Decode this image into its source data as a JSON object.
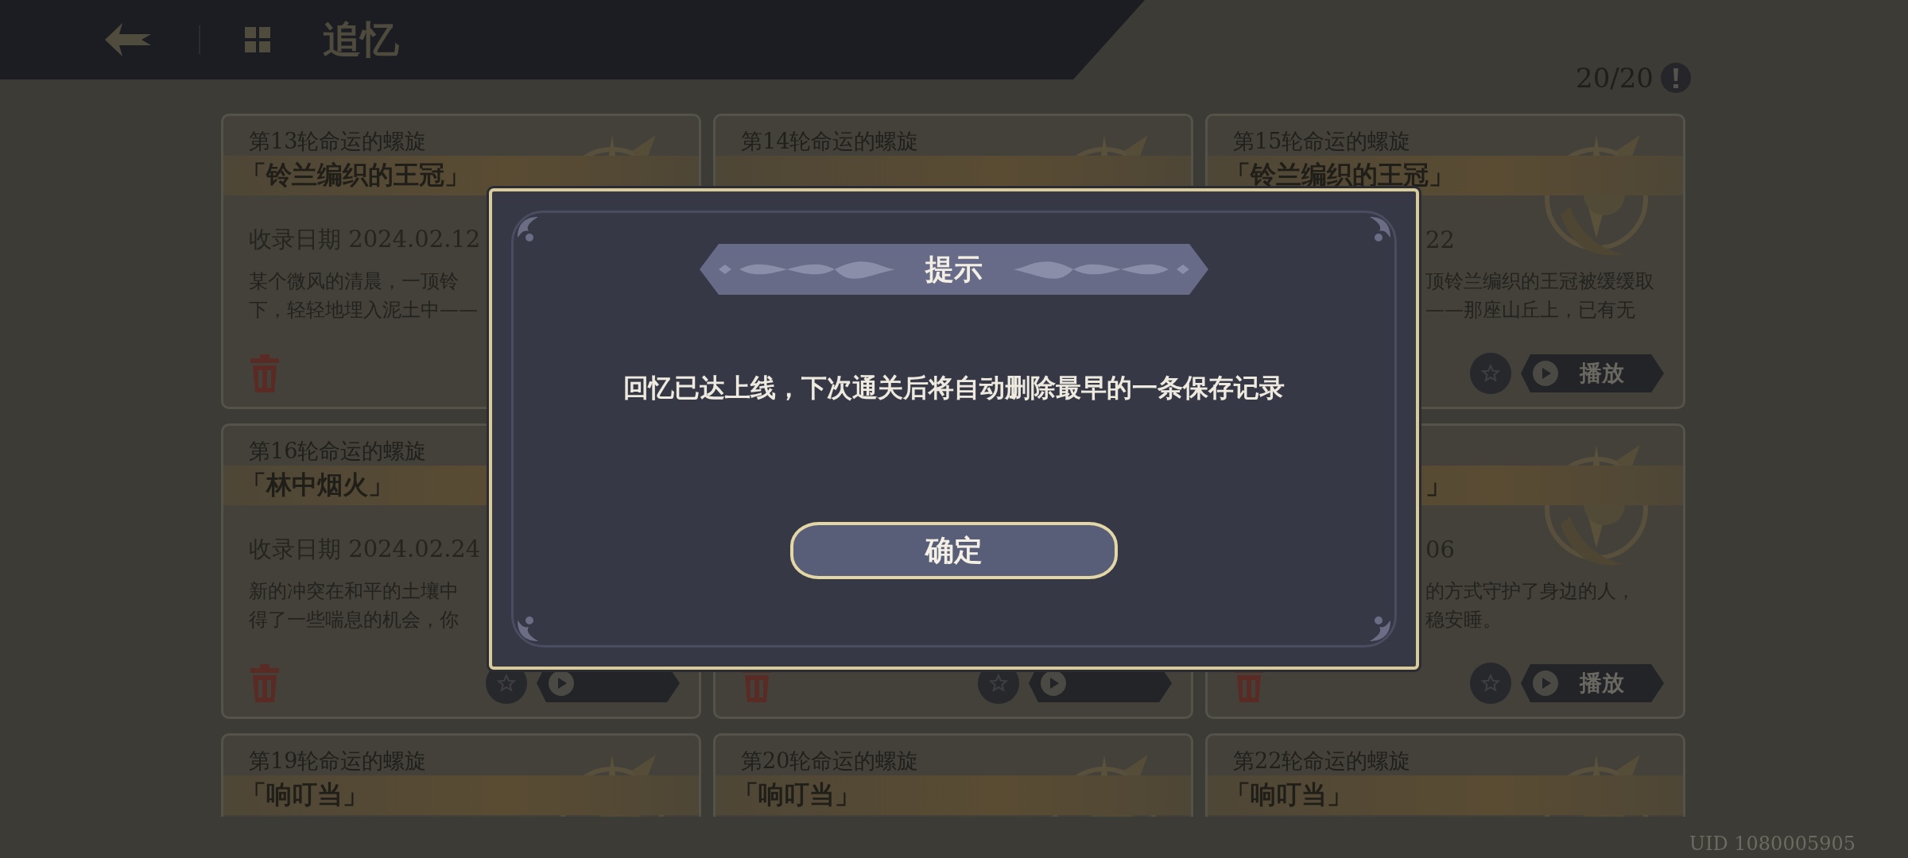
{
  "header": {
    "title": "追忆"
  },
  "counter": {
    "text": "20/20"
  },
  "cards": [
    {
      "emblem": true,
      "title": {
        "text": "第13轮命运的螺旋"
      },
      "subtitle": {
        "text": "「铃兰编织的王冠」",
        "covered_start": false
      },
      "date": {
        "text": "收录日期 2024.02.12",
        "covered_start": false
      },
      "description": [
        {
          "text": "某个微风的清晨，一顶铃",
          "covered_start": false
        },
        {
          "text": "下，轻轻地埋入泥土中——",
          "covered_start": false
        }
      ],
      "buttons": [
        {
          "kind": "delete"
        }
      ]
    },
    {
      "emblem": true,
      "title": {
        "text": "第14轮命运的螺旋"
      }
    },
    {
      "emblem": true,
      "title": {
        "text": "第15轮命运的螺旋"
      },
      "subtitle": {
        "text": "「铃兰编织的王冠」",
        "covered_start": false
      },
      "date": {
        "text": "22",
        "covered_start": true
      },
      "description": [
        {
          "text": "顶铃兰编织的王冠被缓缓取",
          "covered_start": true
        },
        {
          "text": "——那座山丘上，已有无",
          "covered_start": true
        }
      ],
      "buttons": [
        {
          "kind": "favorite"
        },
        {
          "kind": "play",
          "label": "播放"
        }
      ]
    },
    {
      "emblem": false,
      "title": {
        "text": "第16轮命运的螺旋"
      },
      "subtitle": {
        "text": "「林中烟火」",
        "covered_start": false
      },
      "date": {
        "text": "收录日期 2024.02.24",
        "covered_start": false
      },
      "description": [
        {
          "text": "新的冲突在和平的土壤中",
          "covered_start": false
        },
        {
          "text": "得了一些喘息的机会，你",
          "covered_start": false
        }
      ],
      "buttons": [
        {
          "kind": "delete"
        },
        {
          "kind": "favorite"
        },
        {
          "kind": "play"
        }
      ]
    },
    {
      "emblem": false,
      "buttons": [
        {
          "kind": "delete"
        },
        {
          "kind": "favorite"
        },
        {
          "kind": "play"
        }
      ]
    },
    {
      "emblem": true,
      "subtitle": {
        "text": "」",
        "covered_start": true
      },
      "date": {
        "text": "06",
        "covered_start": true
      },
      "description": [
        {
          "text": "的方式守护了身边的人，",
          "covered_start": true
        },
        {
          "text": "稳安睡。",
          "covered_start": true
        }
      ],
      "buttons": [
        {
          "kind": "delete"
        },
        {
          "kind": "favorite"
        },
        {
          "kind": "play",
          "label": "播放"
        }
      ]
    },
    {
      "emblem": true,
      "title": {
        "text": "第19轮命运的螺旋"
      },
      "subtitle": {
        "text": "「响叮当」"
      }
    },
    {
      "emblem": true,
      "title": {
        "text": "第20轮命运的螺旋"
      },
      "subtitle": {
        "text": "「响叮当」"
      }
    },
    {
      "emblem": true,
      "title": {
        "text": "第22轮命运的螺旋"
      },
      "subtitle": {
        "text": "「响叮当」"
      }
    }
  ],
  "dialog": {
    "title": "提示",
    "message": "回忆已达上线，下次通关后将自动删除最早的一条保存记录",
    "confirm": "确定"
  },
  "footer": {
    "uid": "UID 1080005905"
  }
}
